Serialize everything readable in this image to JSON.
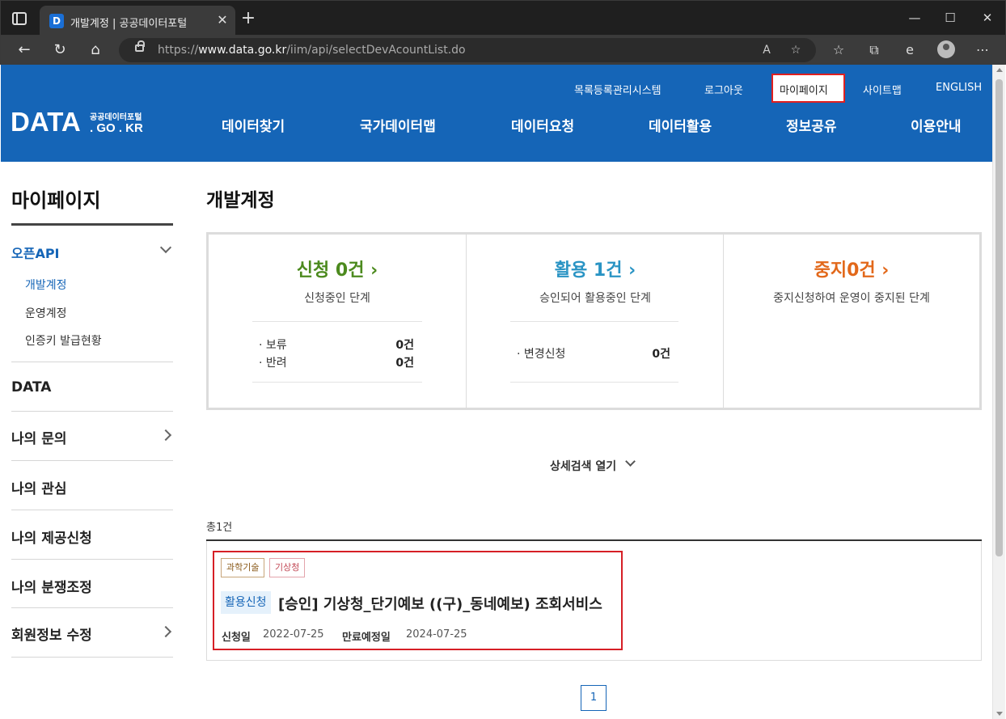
{
  "browser": {
    "tab_title": "개발계정 | 공공데이터포털",
    "favicon_letter": "D",
    "url_prefix": "https://",
    "url_domain": "www.data.go.kr",
    "url_path": "/iim/api/selectDevAcountList.do",
    "icons": [
      "window-icon",
      "close-icon",
      "plus-icon",
      "minimize-icon",
      "maximize-icon",
      "back-icon",
      "refresh-icon",
      "home-icon",
      "lock-icon",
      "read-aloud-icon",
      "add-favorite-icon",
      "favorites-icon",
      "collections-icon",
      "edge-icon",
      "profile-icon",
      "more-icon"
    ]
  },
  "header": {
    "logo_main": "DATA",
    "logo_small": "공공데이터포털",
    "logo_sub": ". GO . KR",
    "util_links": [
      "목록등록관리시스템",
      "로그아웃",
      "마이페이지",
      "사이트맵",
      "ENGLISH"
    ],
    "gnb": [
      "데이터찾기",
      "국가데이터맵",
      "데이터요청",
      "데이터활용",
      "정보공유",
      "이용안내"
    ],
    "brand_color": "#1565b7"
  },
  "sidebar": {
    "title": "마이페이지",
    "open_api": "오픈API",
    "sub_items": [
      "개발계정",
      "운영계정",
      "인증키 발급현황"
    ],
    "items": [
      "DATA",
      "나의 문의",
      "나의 관심",
      "나의 제공신청",
      "나의 분쟁조정",
      "회원정보 수정"
    ]
  },
  "main": {
    "title": "개발계정",
    "summary": [
      {
        "head": "신청 0건 ›",
        "color": "#4c8a1e",
        "desc": "신청중인 단계",
        "rows": [
          {
            "label": "· 보류",
            "value": "0건"
          },
          {
            "label": "· 반려",
            "value": "0건"
          }
        ]
      },
      {
        "head": "활용 1건 ›",
        "color": "#2a94c4",
        "desc": "승인되어 활용중인 단계",
        "rows": [
          {
            "label": "· 변경신청",
            "value": "0건"
          }
        ]
      },
      {
        "head": "중지0건 ›",
        "color": "#e2681a",
        "desc": "중지신청하여 운영이 중지된 단계",
        "rows": []
      }
    ],
    "adv_search": "상세검색 열기",
    "total": "총1건",
    "result": {
      "tags": [
        "과학기술",
        "기상청"
      ],
      "status": "활용신청",
      "title": "[승인] 기상청_단기예보 ((구)_동네예보) 조회서비스",
      "apply_label": "신청일",
      "apply_date": "2022-07-25",
      "expire_label": "만료예정일",
      "expire_date": "2024-07-25"
    },
    "page": "1"
  }
}
